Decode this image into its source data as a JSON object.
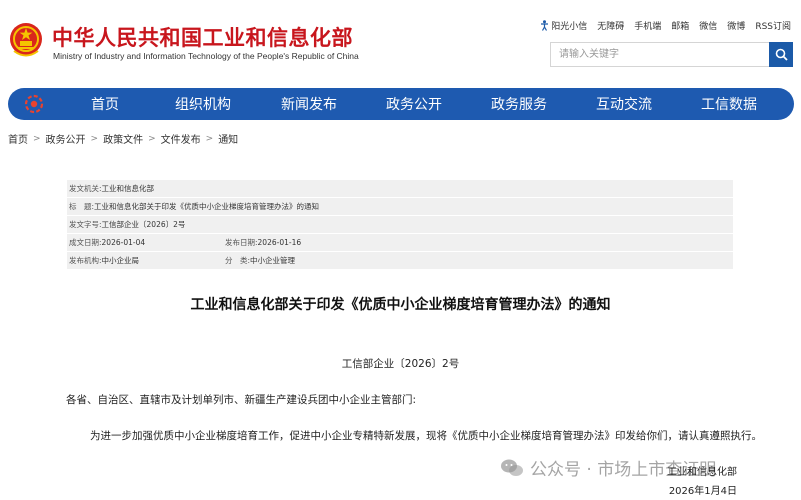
{
  "header": {
    "title": "中华人民共和国工业和信息化部",
    "subtitle": "Ministry of Industry and Information Technology of the People's Republic of China",
    "toplinks": [
      "阳光小信",
      "无障碍",
      "手机端",
      "邮箱",
      "微信",
      "微博",
      "RSS订阅"
    ],
    "search_placeholder": "请输入关键字"
  },
  "nav": {
    "items": [
      "首页",
      "组织机构",
      "新闻发布",
      "政务公开",
      "政务服务",
      "互动交流",
      "工信数据"
    ]
  },
  "breadcrumb": [
    "首页",
    "政务公开",
    "政策文件",
    "文件发布",
    "通知"
  ],
  "meta": {
    "issuer_label": "发文机关:",
    "issuer": "工业和信息化部",
    "title_label": "标　题:",
    "title": "工业和信息化部关于印发《优质中小企业梯度培育管理办法》的通知",
    "docno_label": "发文字号:",
    "docno": "工信部企业〔2026〕2号",
    "created_label": "成文日期:",
    "created": "2026-01-04",
    "published_label": "发布日期:",
    "published": "2026-01-16",
    "org_label": "发布机构:",
    "org": "中小企业局",
    "category_label": "分　类:",
    "category": "中小企业管理"
  },
  "article": {
    "title": "工业和信息化部关于印发《优质中小企业梯度培育管理办法》的通知",
    "number": "工信部企业〔2026〕2号",
    "p1": "各省、自治区、直辖市及计划单列市、新疆生产建设兵团中小企业主管部门:",
    "p2": "为进一步加强优质中小企业梯度培育工作，促进中小企业专精特新发展，现将《优质中小企业梯度培育管理办法》印发给你们，请认真遵照执行。",
    "sign_org": "工业和信息化部",
    "sign_date": "2026年1月4日"
  },
  "watermark": "公众号 · 市场上市查证明",
  "colors": {
    "brand_red": "#c8161d",
    "nav_blue": "#1e5ab0",
    "search_blue": "#1b5aa8",
    "meta_bg": "#f0f0f0"
  },
  "icons": [
    "emblem-icon",
    "accessibility-icon",
    "search-icon",
    "nav-logo-icon",
    "wechat-icon"
  ]
}
